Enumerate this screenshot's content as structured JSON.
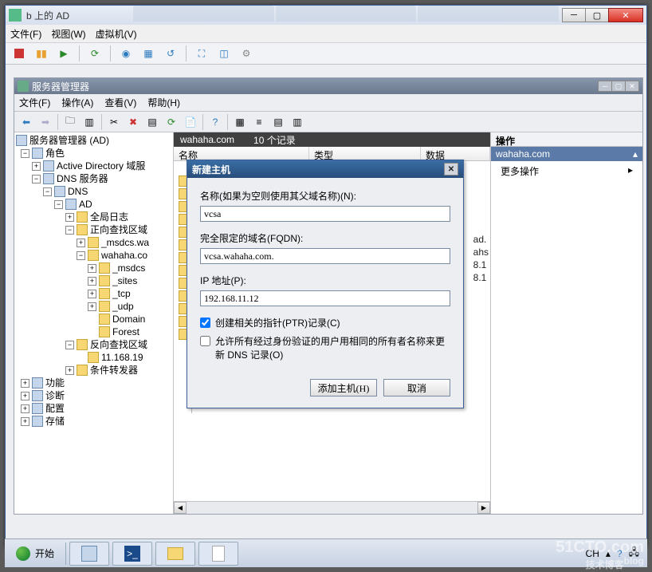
{
  "outer": {
    "title": "b 上的 AD",
    "menu": {
      "file": "文件(F)",
      "view": "视图(W)",
      "vm": "虚拟机(V)"
    }
  },
  "inner": {
    "title": "服务器管理器",
    "menu": {
      "file": "文件(F)",
      "action": "操作(A)",
      "view": "查看(V)",
      "help": "帮助(H)"
    }
  },
  "tree": {
    "root": "服务器管理器 (AD)",
    "roles": "角色",
    "ad": "Active Directory 域服",
    "dns_server": "DNS 服务器",
    "dns": "DNS",
    "ad_node": "AD",
    "global_log": "全局日志",
    "fwd_zone": "正向查找区域",
    "msdcs": "_msdcs.wa",
    "wahaha": "wahaha.co",
    "sub_msdcs": "_msdcs",
    "sub_sites": "_sites",
    "sub_tcp": "_tcp",
    "sub_udp": "_udp",
    "sub_domain": "Domain",
    "sub_forest": "Forest",
    "rev_zone": "反向查找区域",
    "rev_ip": "11.168.19",
    "cond_fwd": "条件转发器",
    "features": "功能",
    "diagnostics": "诊断",
    "config": "配置",
    "storage": "存储"
  },
  "center": {
    "domain": "wahaha.com",
    "records": "10 个记录",
    "col_name": "名称",
    "col_type": "类型",
    "col_data": "数据",
    "peek1": "ad.",
    "peek2": "ahs",
    "peek3": "8.1",
    "peek4": "8.1"
  },
  "dialog": {
    "title": "新建主机",
    "name_label": "名称(如果为空则使用其父域名称)(N):",
    "name_value": "vcsa",
    "fqdn_label": "完全限定的域名(FQDN):",
    "fqdn_value": "vcsa.wahaha.com.",
    "ip_label": "IP 地址(P):",
    "ip_value": "192.168.11.12",
    "chk_ptr": "创建相关的指针(PTR)记录(C)",
    "chk_allow": "允许所有经过身份验证的用户用相同的所有者名称来更新 DNS 记录(O)",
    "btn_add": "添加主机(H)",
    "btn_cancel": "取消"
  },
  "right": {
    "head": "操作",
    "domain": "wahaha.com",
    "more": "更多操作"
  },
  "taskbar": {
    "start": "开始",
    "lang": "CH"
  }
}
